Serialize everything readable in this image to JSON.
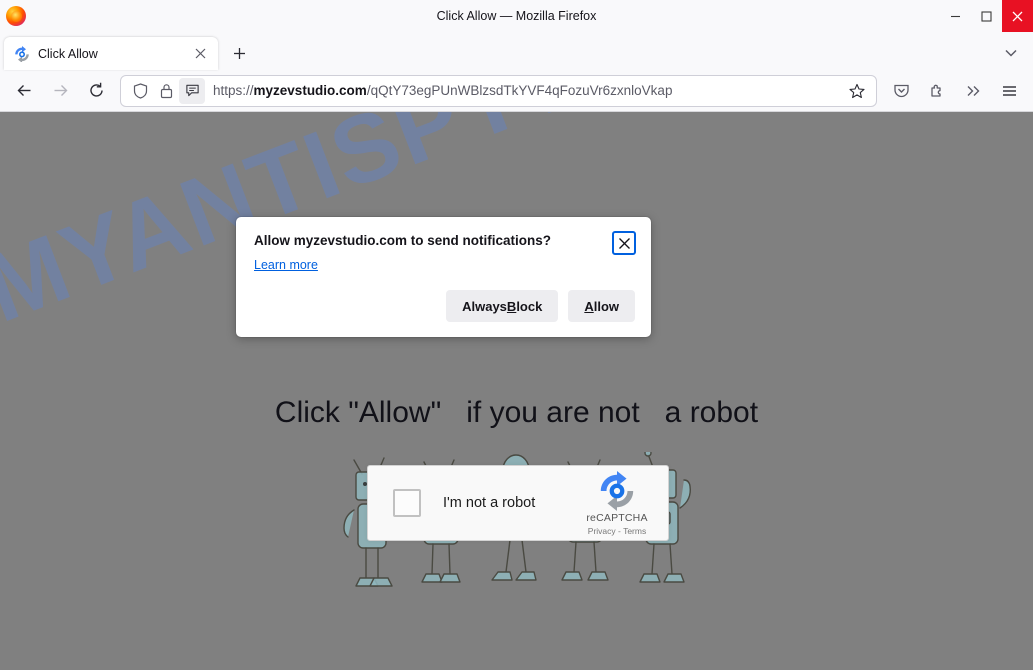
{
  "window": {
    "title": "Click Allow — Mozilla Firefox",
    "controls": {
      "minimize": "minimize",
      "maximize": "maximize",
      "close": "close"
    }
  },
  "tabstrip": {
    "tabs": [
      {
        "title": "Click Allow",
        "favicon": "recaptcha-icon",
        "close_label": "×"
      }
    ],
    "new_tab_label": "+",
    "all_tabs_label": "List all tabs"
  },
  "navbar": {
    "back_label": "Go back one page",
    "forward_label": "Go forward one page",
    "reload_label": "Reload current page",
    "url": {
      "scheme": "https://",
      "host": "myzevstudio.com",
      "path": "/qQtY73egPUnWBlzsdTkYVF4qFozuVr6zxnloVkap"
    },
    "icons": {
      "shield": "shield-icon",
      "lock": "lock-icon",
      "permission": "notification-bubble-icon",
      "bookmark": "star-icon",
      "pocket": "pocket-icon",
      "extensions": "extensions-puzzle-icon",
      "overflow": "chevrons-right-icon",
      "menu": "hamburger-menu-icon"
    }
  },
  "doorhanger": {
    "title": "Allow myzevstudio.com to send notifications?",
    "learn_more": "Learn more",
    "always_block": {
      "pre": "Always ",
      "accel": "B",
      "post": "lock"
    },
    "allow": {
      "accel": "A",
      "post": "llow"
    },
    "close_label": "×"
  },
  "page": {
    "background_color": "#808080",
    "watermark": "MYANTISPYWARE.COM",
    "watermark_color": "#6b83b5",
    "headline": "Click \"Allow\"   if you are not   a robot",
    "recaptcha": {
      "checkbox_label": "I'm not a robot",
      "brand": "reCAPTCHA",
      "legal": "Privacy - Terms"
    },
    "illustration": "cartoon-robots"
  }
}
